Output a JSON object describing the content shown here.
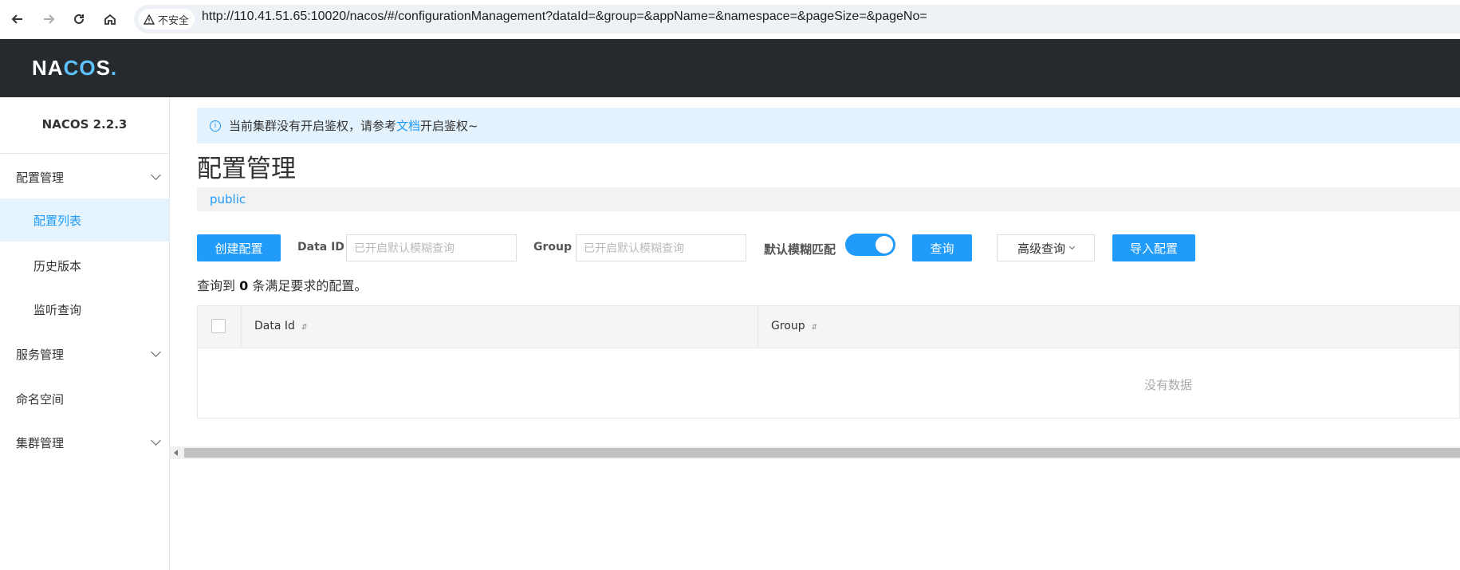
{
  "browser": {
    "security_label": "不安全",
    "url": "http://110.41.51.65:10020/nacos/#/configurationManagement?dataId=&group=&appName=&namespace=&pageSize=&pageNo="
  },
  "header": {
    "logo_text_1": "NA",
    "logo_text_2": "C",
    "logo_text_3": "O",
    "logo_text_4": "S",
    "logo_text_5": "."
  },
  "sidebar": {
    "version": "NACOS 2.2.3",
    "items": [
      {
        "label": "配置管理"
      },
      {
        "label": "配置列表"
      },
      {
        "label": "历史版本"
      },
      {
        "label": "监听查询"
      },
      {
        "label": "服务管理"
      },
      {
        "label": "命名空间"
      },
      {
        "label": "集群管理"
      }
    ]
  },
  "notice": {
    "text_before": "当前集群没有开启鉴权，请参考",
    "link": "文档",
    "text_after": "开启鉴权~"
  },
  "page": {
    "title": "配置管理",
    "namespace": "public"
  },
  "toolbar": {
    "create_label": "创建配置",
    "dataid_label": "Data ID",
    "dataid_placeholder": "已开启默认模糊查询",
    "group_label": "Group",
    "group_placeholder": "已开启默认模糊查询",
    "fuzzy_label": "默认模糊匹配",
    "fuzzy_on": true,
    "query_label": "查询",
    "advanced_label": "高级查询",
    "import_label": "导入配置"
  },
  "result": {
    "prefix": "查询到",
    "count": "0",
    "suffix": "条满足要求的配置。"
  },
  "table": {
    "columns": [
      "Data Id",
      "Group"
    ],
    "sort_icon": "⇵",
    "empty_text": "没有数据"
  },
  "colors": {
    "primary": "#209bfa",
    "header_bg": "#252a2f",
    "notice_bg": "#e3f2fd",
    "active_bg": "#e5f3ff"
  }
}
